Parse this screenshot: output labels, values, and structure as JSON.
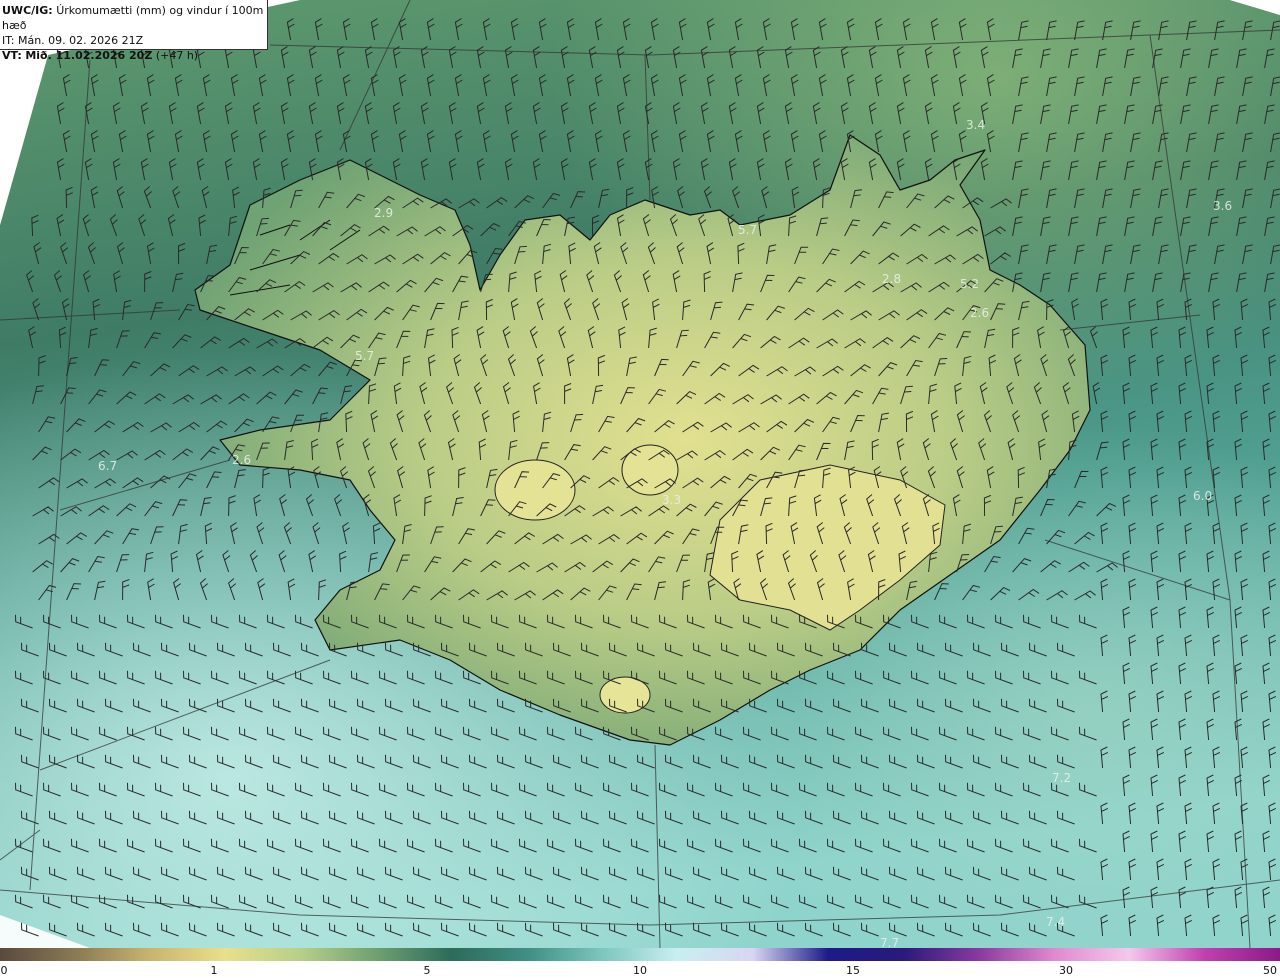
{
  "title": {
    "model": "UWC/IG:",
    "description": "Úrkomumætti (mm) og vindur í 100m hæð",
    "init_time": "IT: Mán. 09. 02. 2026 21Z",
    "valid_prefix": "VT:",
    "valid_time": "Mið. 11.02.2026 20Z",
    "lead": "(+47 h)"
  },
  "value_labels": [
    "3.4",
    "3.6",
    "5.7",
    "2.9",
    "2.8",
    "5.2",
    "2.6",
    "5.7",
    "6.7",
    "2.6",
    "3.3",
    "6.0",
    "7.2",
    "7.4",
    "7.7"
  ],
  "colorbar": {
    "ticks": [
      "0",
      "1",
      "5",
      "10",
      "15",
      "30",
      "50"
    ],
    "colors": [
      "#5a4a3c",
      "#8a7a55",
      "#c9b56e",
      "#e8e08a",
      "#b7cf88",
      "#6fa070",
      "#2d6b5a",
      "#3f8f84",
      "#7cc7be",
      "#c9eef0",
      "#d8d6f2",
      "#1d1a8a",
      "#2a1a7a",
      "#8a3aa0",
      "#e08ad0",
      "#f4c8ec",
      "#c040b0",
      "#8a1a8a"
    ]
  },
  "legend_colors": {
    "ocean_dark": "#3d7a64",
    "ocean_light": "#7cc8c0",
    "land_high": "#e0e090",
    "land_mid": "#a8c07e",
    "coast": "#111111"
  }
}
